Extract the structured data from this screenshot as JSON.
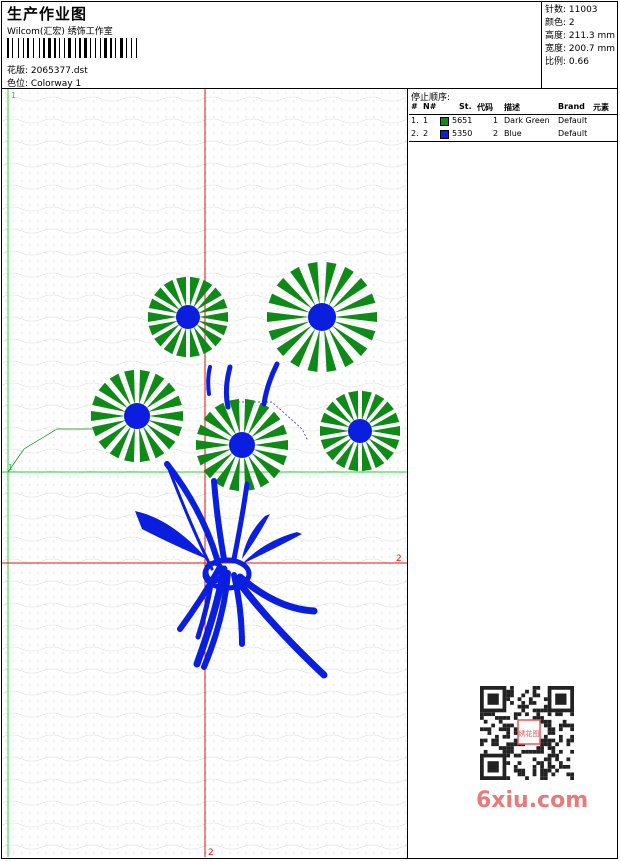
{
  "header": {
    "title": "生产作业图",
    "company": "Wilcom(汇宏) 绣饰工作室",
    "design_file": "花版: 2065377.dst",
    "colorway": "色位: Colorway 1"
  },
  "stats": {
    "stitches": "针数: 11003",
    "colors": "颜色: 2",
    "height": "高度: 211.3 mm",
    "width": "宽度: 200.7 mm",
    "scale": "比例: 0.66"
  },
  "stop_sequence": {
    "title": "停止顺序:",
    "columns": [
      "#",
      "N#",
      "St.",
      "代码",
      "描述",
      "Brand",
      "元素"
    ],
    "rows": [
      {
        "index": "1.",
        "n": "1",
        "color": "#0f8a18",
        "st": "5651",
        "code": "1",
        "desc": "Dark Green",
        "brand": "Default"
      },
      {
        "index": "2.",
        "n": "2",
        "color": "#0a1ee0",
        "st": "5350",
        "code": "2",
        "desc": "Blue",
        "brand": "Default"
      }
    ]
  },
  "canvas": {
    "marker_1_top": "1",
    "marker_1_left": "1",
    "marker_2_right": "2",
    "marker_2_bottom": "2",
    "green": "#0f8a18",
    "blue": "#0a1ee0"
  },
  "watermark": {
    "text": "6xiu.com",
    "seal": "绣花图"
  }
}
